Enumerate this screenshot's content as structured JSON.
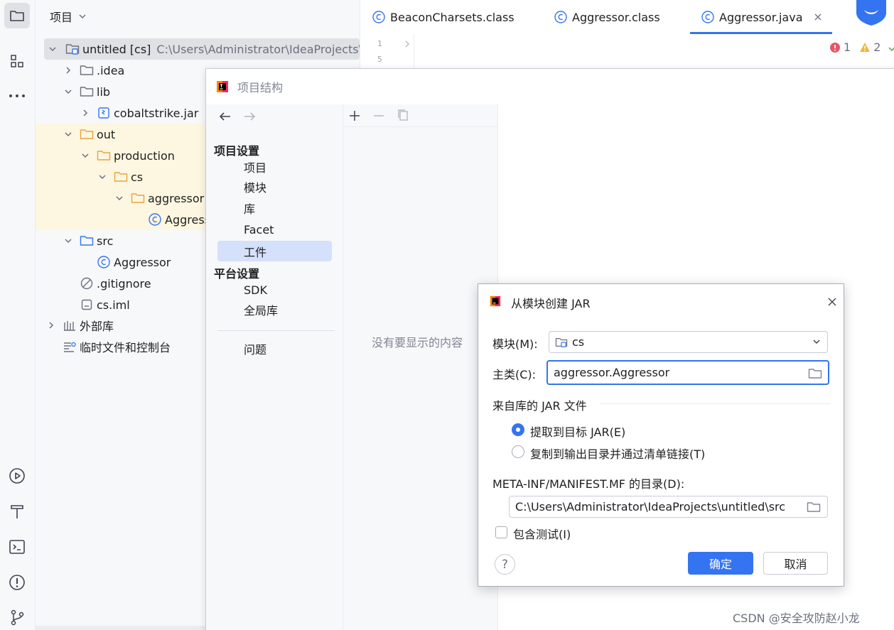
{
  "colors": {
    "accent": "#3574f0",
    "error": "#e55765",
    "warning": "#f2b63c",
    "ok": "#5fb865",
    "highlight_bg": "#fdf6e0",
    "folder_orange": "#e8a33d",
    "folder_blue": "#3574f0"
  },
  "toolstrip": {
    "icons": [
      "folder-icon",
      "structure-icon",
      "more-icon",
      "run-icon",
      "build-icon",
      "terminal-icon",
      "problems-icon",
      "git-icon"
    ]
  },
  "project_panel": {
    "title": "项目",
    "tree": [
      {
        "label": "untitled [cs]",
        "path": "C:\\Users\\Administrator\\IdeaProjects\\untitled"
      },
      {
        "label": ".idea"
      },
      {
        "label": "lib"
      },
      {
        "label": "cobaltstrike.jar"
      },
      {
        "label": "out"
      },
      {
        "label": "production"
      },
      {
        "label": "cs"
      },
      {
        "label": "aggressor"
      },
      {
        "label": "Aggressor"
      },
      {
        "label": "src"
      },
      {
        "label": "Aggressor"
      },
      {
        "label": ".gitignore"
      },
      {
        "label": "cs.iml"
      },
      {
        "label": "外部库"
      },
      {
        "label": "临时文件和控制台"
      }
    ]
  },
  "editor": {
    "tabs": [
      {
        "label": "BeaconCharsets.class"
      },
      {
        "label": "Aggressor.class"
      },
      {
        "label": "Aggressor.java",
        "active": true
      }
    ],
    "line_numbers": [
      "1",
      "5"
    ],
    "inspections": {
      "errors": "1",
      "warnings": "2"
    }
  },
  "project_structure": {
    "title": "项目结构",
    "groups": [
      {
        "title": "项目设置",
        "items": [
          "项目",
          "模块",
          "库",
          "Facet",
          "工件"
        ]
      },
      {
        "title": "平台设置",
        "items": [
          "SDK",
          "全局库"
        ]
      }
    ],
    "problems": "问题",
    "selected": "工件",
    "empty_text": "没有要显示的内容"
  },
  "jar_dialog": {
    "title": "从模块创建 JAR",
    "module_label": "模块(M):",
    "module_value": "cs",
    "main_class_label": "主类(C):",
    "main_class_value": "aggressor.Aggressor",
    "section_label": "来自库的 JAR 文件",
    "radio_extract": "提取到目标 JAR(E)",
    "radio_copy": "复制到输出目录并通过清单链接(T)",
    "manifest_label": "META-INF/MANIFEST.MF 的目录(D):",
    "manifest_value": "C:\\Users\\Administrator\\IdeaProjects\\untitled\\src",
    "include_tests": "包含测试(I)",
    "ok": "确定",
    "cancel": "取消"
  },
  "watermark": "CSDN @安全攻防赵小龙"
}
